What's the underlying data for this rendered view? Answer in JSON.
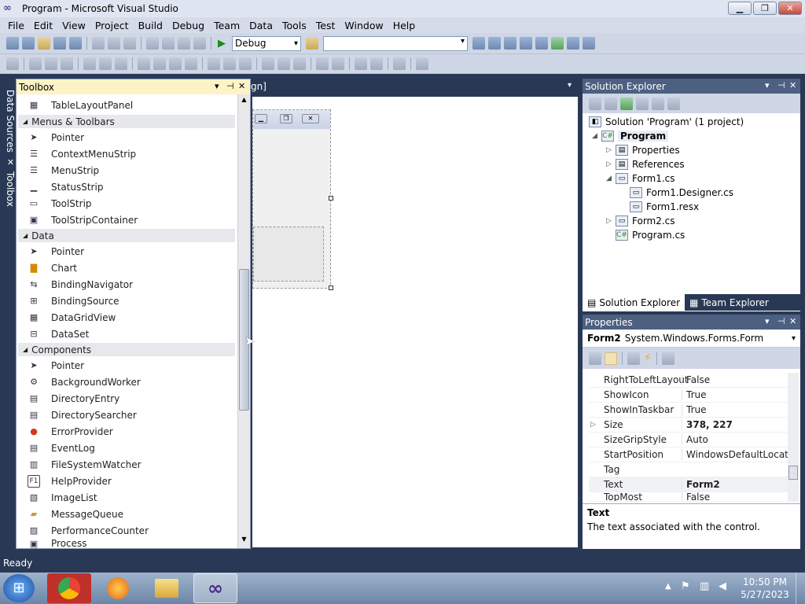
{
  "window": {
    "title": "Program - Microsoft Visual Studio",
    "min": "▁",
    "max": "❐",
    "close": "✕"
  },
  "menu": [
    "File",
    "Edit",
    "View",
    "Project",
    "Build",
    "Debug",
    "Team",
    "Data",
    "Tools",
    "Test",
    "Window",
    "Help"
  ],
  "toolbar": {
    "config": "Debug",
    "platform": ""
  },
  "sidetabs": {
    "data_sources": "Data Sources",
    "toolbox": "Toolbox"
  },
  "toolbox": {
    "title": "Toolbox",
    "top_item": "TableLayoutPanel",
    "groups": [
      {
        "name": "Menus & Toolbars",
        "items": [
          "Pointer",
          "ContextMenuStrip",
          "MenuStrip",
          "StatusStrip",
          "ToolStrip",
          "ToolStripContainer"
        ]
      },
      {
        "name": "Data",
        "items": [
          "Pointer",
          "Chart",
          "BindingNavigator",
          "BindingSource",
          "DataGridView",
          "DataSet"
        ]
      },
      {
        "name": "Components",
        "items": [
          "Pointer",
          "BackgroundWorker",
          "DirectoryEntry",
          "DirectorySearcher",
          "ErrorProvider",
          "EventLog",
          "FileSystemWatcher",
          "HelpProvider",
          "ImageList",
          "MessageQueue",
          "PerformanceCounter",
          "Process"
        ]
      }
    ]
  },
  "designer": {
    "tab": "gn]"
  },
  "solution_explorer": {
    "title": "Solution Explorer",
    "nodes": [
      "Solution 'Program' (1 project)",
      "Program",
      "Properties",
      "References",
      "Form1.cs",
      "Form1.Designer.cs",
      "Form1.resx",
      "Form2.cs",
      "Program.cs"
    ],
    "tabs": [
      "Solution Explorer",
      "Team Explorer"
    ]
  },
  "properties": {
    "title": "Properties",
    "object_name": "Form2",
    "object_type": "System.Windows.Forms.Form",
    "rows": [
      {
        "name": "RightToLeftLayout",
        "value": "False"
      },
      {
        "name": "ShowIcon",
        "value": "True"
      },
      {
        "name": "ShowInTaskbar",
        "value": "True"
      },
      {
        "name": "Size",
        "value": "378, 227"
      },
      {
        "name": "SizeGripStyle",
        "value": "Auto"
      },
      {
        "name": "StartPosition",
        "value": "WindowsDefaultLocati"
      },
      {
        "name": "Tag",
        "value": ""
      },
      {
        "name": "Text",
        "value": "Form2"
      },
      {
        "name": "TopMost",
        "value": "False"
      }
    ],
    "desc_title": "Text",
    "desc_text": "The text associated with the control."
  },
  "status": "Ready",
  "clock": {
    "time": "10:50 PM",
    "date": "5/27/2023"
  },
  "colors": {
    "chrome": "#293955",
    "accent_tab": "#fdf3c6",
    "taskbar": "#8aa0bd"
  }
}
